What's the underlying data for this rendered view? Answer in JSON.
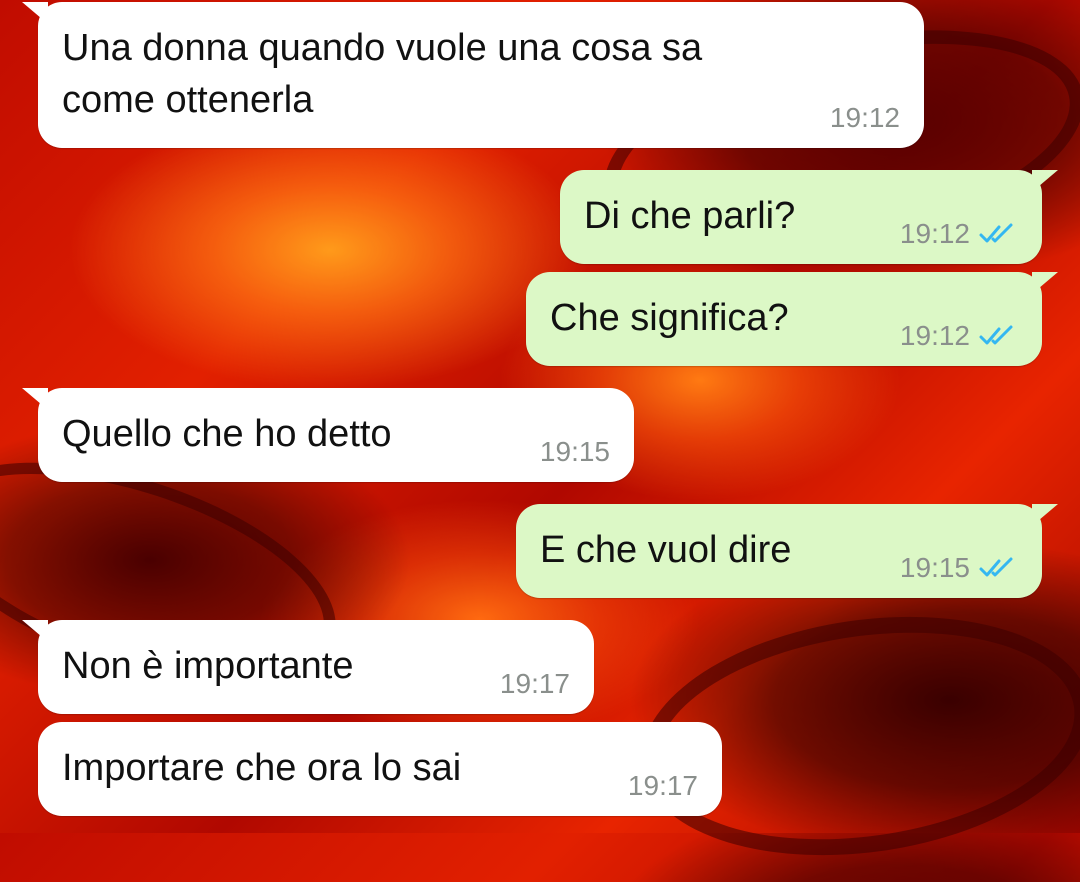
{
  "colors": {
    "incoming_bubble": "#ffffff",
    "outgoing_bubble": "#dcf8c6",
    "timestamp": "#8a8f8c",
    "read_ticks": "#34b7f1"
  },
  "messages": [
    {
      "direction": "incoming",
      "text": "Una donna quando vuole una cosa sa\ncome ottenerla",
      "time": "19:12"
    },
    {
      "direction": "outgoing",
      "text": "Di che parli?",
      "time": "19:12",
      "status_icon": "double-check-read-icon"
    },
    {
      "direction": "outgoing",
      "text": "Che significa?",
      "time": "19:12",
      "status_icon": "double-check-read-icon"
    },
    {
      "direction": "incoming",
      "text": "Quello che ho detto",
      "time": "19:15"
    },
    {
      "direction": "outgoing",
      "text": "E che vuol dire",
      "time": "19:15",
      "status_icon": "double-check-read-icon"
    },
    {
      "direction": "incoming",
      "text": "Non è importante",
      "time": "19:17"
    },
    {
      "direction": "incoming",
      "text": "Importare che ora lo sai",
      "time": "19:17"
    }
  ]
}
